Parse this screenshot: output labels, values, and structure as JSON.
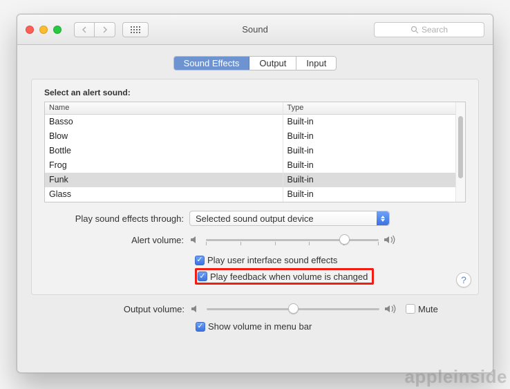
{
  "window": {
    "title": "Sound"
  },
  "search": {
    "placeholder": "Search"
  },
  "tabs": {
    "effects": "Sound Effects",
    "output": "Output",
    "input": "Input",
    "active": "effects"
  },
  "alerts": {
    "label": "Select an alert sound:",
    "columns": {
      "name": "Name",
      "type": "Type"
    },
    "rows": [
      {
        "name": "Basso",
        "type": "Built-in"
      },
      {
        "name": "Blow",
        "type": "Built-in"
      },
      {
        "name": "Bottle",
        "type": "Built-in"
      },
      {
        "name": "Frog",
        "type": "Built-in"
      },
      {
        "name": "Funk",
        "type": "Built-in"
      },
      {
        "name": "Glass",
        "type": "Built-in"
      }
    ],
    "selected_index": 4
  },
  "play_through": {
    "label": "Play sound effects through:",
    "value": "Selected sound output device"
  },
  "alert_volume": {
    "label": "Alert volume:",
    "value": 0.82
  },
  "checks": {
    "ui_sounds": {
      "label": "Play user interface sound effects",
      "checked": true
    },
    "feedback": {
      "label": "Play feedback when volume is changed",
      "checked": true
    }
  },
  "output_volume": {
    "label": "Output volume:",
    "value": 0.5,
    "mute_label": "Mute",
    "mute": false
  },
  "menubar": {
    "label": "Show volume in menu bar",
    "checked": true
  },
  "watermark": "appleinside"
}
